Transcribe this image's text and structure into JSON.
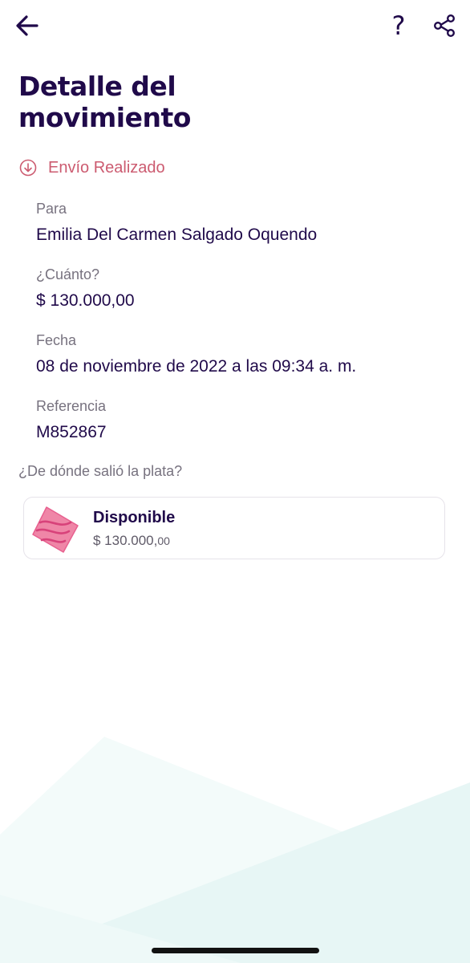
{
  "header": {
    "back_icon": "arrow-left-icon",
    "help_label": "?",
    "share_icon": "share-icon"
  },
  "title": "Detalle del movimiento",
  "status": {
    "icon": "arrow-down-circle-icon",
    "label": "Envío Realizado",
    "color": "#cc5b70"
  },
  "details": {
    "para": {
      "label": "Para",
      "value": "Emilia Del Carmen Salgado Oquendo"
    },
    "cuanto": {
      "label": "¿Cuánto?",
      "value": "$ 130.000,00"
    },
    "fecha": {
      "label": "Fecha",
      "value": "08 de noviembre de 2022 a las 09:34 a. m."
    },
    "referencia": {
      "label": "Referencia",
      "value": "M852867"
    }
  },
  "source": {
    "question": "¿De dónde salió la plata?",
    "account": {
      "icon": "pocket-icon",
      "name": "Disponible",
      "amount_main": "$ 130.000,",
      "amount_cents": "00"
    }
  },
  "theme": {
    "primary": "#200a4a",
    "muted": "#77727f",
    "accent_pink": "#e8608f",
    "background_wave": "#eaf7f6"
  }
}
